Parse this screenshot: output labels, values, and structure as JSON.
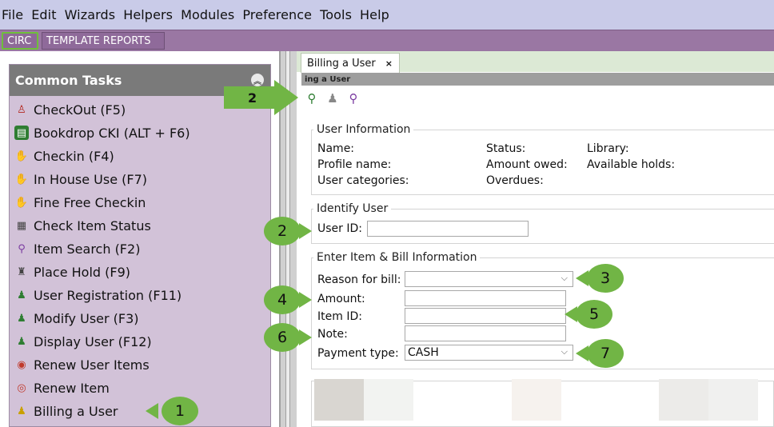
{
  "menu": [
    "File",
    "Edit",
    "Wizards",
    "Helpers",
    "Modules",
    "Preference",
    "Tools",
    "Help"
  ],
  "modules": {
    "active": "CIRC",
    "other": "TEMPLATE REPORTS"
  },
  "common_tasks": {
    "title": "Common Tasks",
    "items": [
      {
        "label": "CheckOut (F5)",
        "icon": "checkout-stamp-icon"
      },
      {
        "label": "Bookdrop CKI (ALT + F6)",
        "icon": "bookdrop-icon"
      },
      {
        "label": "Checkin (F4)",
        "icon": "checkin-icon"
      },
      {
        "label": "In House Use (F7)",
        "icon": "in-house-use-icon"
      },
      {
        "label": "Fine Free Checkin",
        "icon": "fine-free-checkin-icon"
      },
      {
        "label": "Check Item Status",
        "icon": "item-status-icon"
      },
      {
        "label": "Item Search (F2)",
        "icon": "item-search-icon"
      },
      {
        "label": "Place Hold (F9)",
        "icon": "place-hold-icon"
      },
      {
        "label": "User Registration (F11)",
        "icon": "user-registration-icon"
      },
      {
        "label": "Modify User (F3)",
        "icon": "modify-user-icon"
      },
      {
        "label": "Display User (F12)",
        "icon": "display-user-icon"
      },
      {
        "label": "Renew User Items",
        "icon": "renew-user-items-icon"
      },
      {
        "label": "Renew Item",
        "icon": "renew-item-icon"
      },
      {
        "label": "Billing a User",
        "icon": "billing-user-icon"
      }
    ]
  },
  "doc_tab": {
    "label": "Billing a User",
    "close": "×"
  },
  "window_title": "ing a User",
  "user_info": {
    "legend": "User Information",
    "name": "Name:",
    "profile": "Profile name:",
    "categories": "User categories:",
    "status": "Status:",
    "amount_owed": "Amount owed:",
    "overdues": "Overdues:",
    "library": "Library:",
    "holds": "Available holds:"
  },
  "identify": {
    "legend": "Identify User",
    "user_id_label": "User ID:",
    "user_id_value": ""
  },
  "bill": {
    "legend": "Enter Item & Bill Information",
    "reason_label": "Reason for bill:",
    "reason_value": "",
    "amount_label": "Amount:",
    "item_label": "Item ID:",
    "note_label": "Note:",
    "payment_label": "Payment type:",
    "payment_value": "CASH"
  },
  "callouts": {
    "one": "1",
    "two_toolbar": "2",
    "two_user": "2",
    "three": "3",
    "four": "4",
    "five": "5",
    "six": "6",
    "seven": "7"
  },
  "colors": {
    "callout": "#71b545",
    "menubar": "#c9cbe8",
    "module_bar": "#9a77a3",
    "task_panel": "#d2c2d8"
  }
}
